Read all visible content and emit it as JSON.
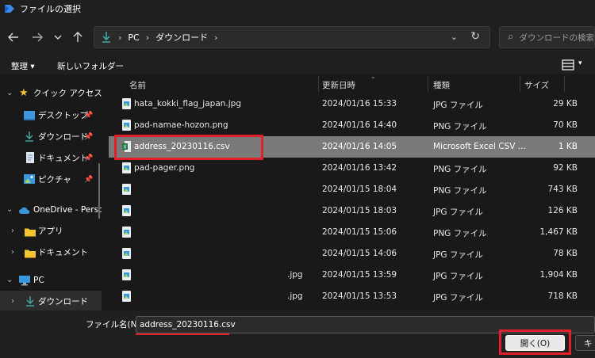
{
  "window": {
    "title": "ファイルの選択",
    "accent": "#e0202b"
  },
  "nav": {
    "back_icon": "arrow-left-icon",
    "forward_icon": "arrow-right-icon",
    "recent_icon": "chevron-down-icon",
    "up_icon": "arrow-up-icon",
    "breadcrumb": [
      "PC",
      "ダウンロード"
    ],
    "search_placeholder": "ダウンロードの検索"
  },
  "toolbar": {
    "organize": "整理 ▾",
    "new_folder": "新しいフォルダー"
  },
  "sidebar": {
    "quick_access": "クイック アクセス",
    "items": [
      {
        "label": "デスクトップ",
        "icon": "desktop-icon",
        "pinned": true
      },
      {
        "label": "ダウンロード",
        "icon": "download-icon",
        "pinned": true
      },
      {
        "label": "ドキュメント",
        "icon": "document-icon",
        "pinned": true
      },
      {
        "label": "ピクチャ",
        "icon": "picture-icon",
        "pinned": true
      }
    ],
    "onedrive": "OneDrive - Perso",
    "onedrive_children": [
      "アプリ",
      "ドキュメント"
    ],
    "pc": "PC",
    "pc_children": [
      "ダウンロード"
    ]
  },
  "columns": {
    "name": "名前",
    "date": "更新日時",
    "type": "種類",
    "size": "サイズ"
  },
  "files": [
    {
      "name": "hata_kokki_flag_japan.jpg",
      "ext": "",
      "date": "2024/01/16 15:33",
      "type": "JPG ファイル",
      "size": "29 KB",
      "icon": "image-file-icon"
    },
    {
      "name": "pad-namae-hozon.png",
      "ext": "",
      "date": "2024/01/16 14:40",
      "type": "PNG ファイル",
      "size": "70 KB",
      "icon": "image-file-icon"
    },
    {
      "name": "address_20230116.csv",
      "ext": "",
      "date": "2024/01/16 14:05",
      "type": "Microsoft Excel CSV ...",
      "size": "1 KB",
      "icon": "excel-csv-icon"
    },
    {
      "name": "pad-pager.png",
      "ext": "",
      "date": "2024/01/16 13:42",
      "type": "PNG ファイル",
      "size": "92 KB",
      "icon": "image-file-icon"
    },
    {
      "name": "",
      "ext": "",
      "date": "2024/01/15 18:04",
      "type": "PNG ファイル",
      "size": "743 KB",
      "icon": "image-file-icon"
    },
    {
      "name": "",
      "ext": "",
      "date": "2024/01/15 18:03",
      "type": "JPG ファイル",
      "size": "126 KB",
      "icon": "image-file-icon"
    },
    {
      "name": "",
      "ext": "",
      "date": "2024/01/15 15:06",
      "type": "PNG ファイル",
      "size": "1,467 KB",
      "icon": "image-file-icon"
    },
    {
      "name": "",
      "ext": "",
      "date": "2024/01/15 14:06",
      "type": "JPG ファイル",
      "size": "78 KB",
      "icon": "image-file-icon"
    },
    {
      "name": "",
      "ext": ".jpg",
      "date": "2024/01/15 13:59",
      "type": "JPG ファイル",
      "size": "1,904 KB",
      "icon": "image-file-icon"
    },
    {
      "name": "",
      "ext": ".jpg",
      "date": "2024/01/15 13:53",
      "type": "JPG ファイル",
      "size": "718 KB",
      "icon": "image-file-icon"
    }
  ],
  "selected_file": "address_20230116.csv",
  "footer": {
    "filename_label": "ファイル名(N):",
    "filename_value": "address_20230116.csv",
    "open_button": "開く(O)",
    "cancel_button": "キ"
  }
}
